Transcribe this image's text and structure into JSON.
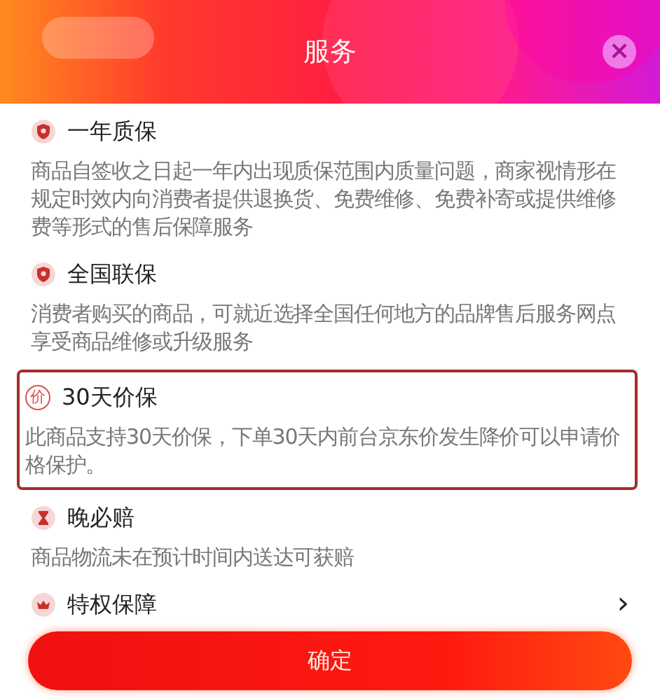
{
  "header": {
    "title": "服务",
    "close": "×"
  },
  "items": [
    {
      "kind": "shield",
      "title": "一年质保",
      "description": "商品自签收之日起一年内出现质保范围内质量问题，商家视情形在规定时效内向消费者提供退换货、免费维修、免费补寄或提供维修费等形式的售后保障服务",
      "highlighted": false
    },
    {
      "kind": "shield",
      "title": "全国联保",
      "description": "消费者购买的商品，可就近选择全国任何地方的品牌售后服务网点享受商品维修或升级服务",
      "highlighted": false
    },
    {
      "kind": "glyph",
      "icon_text": "价",
      "title": "30天价保",
      "description": "此商品支持30天价保，下单30天内前台京东价发生降价可以申请价格保护。",
      "highlighted": true
    },
    {
      "kind": "hourglass",
      "title": "晚必赔",
      "description": "商品物流未在预计时间内送达可获赔",
      "highlighted": false
    },
    {
      "kind": "crown",
      "title": "特权保障",
      "arrow": "›",
      "highlighted": false
    }
  ],
  "confirm_button": "确定"
}
